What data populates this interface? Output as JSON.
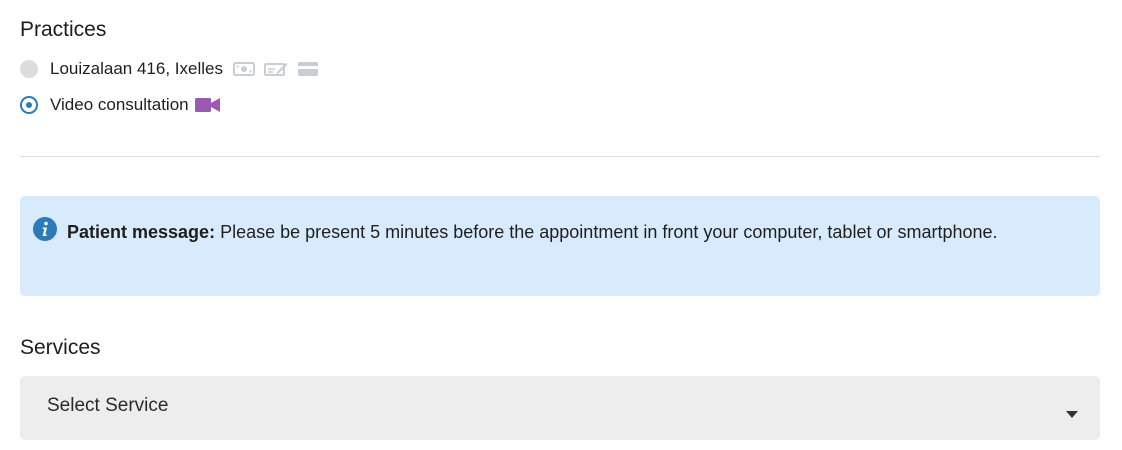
{
  "practices": {
    "title": "Practices",
    "options": [
      {
        "label": "Louizalaan 416, Ixelles",
        "selected": false,
        "icons": [
          "cash-icon",
          "check-icon",
          "card-icon"
        ]
      },
      {
        "label": "Video consultation",
        "selected": true,
        "icons": [
          "video-camera-icon"
        ]
      }
    ]
  },
  "patient_message": {
    "label": "Patient message:",
    "text": " Please be present 5 minutes before the appointment in front your computer, tablet or smartphone."
  },
  "services": {
    "title": "Services",
    "select_value": "Select Service"
  },
  "colors": {
    "accent_blue": "#2b7bb9",
    "video_purple": "#9b59b6",
    "info_background": "#d7ebfc",
    "select_background": "#ededed",
    "payment_icon_gray": "#c9ced4"
  }
}
